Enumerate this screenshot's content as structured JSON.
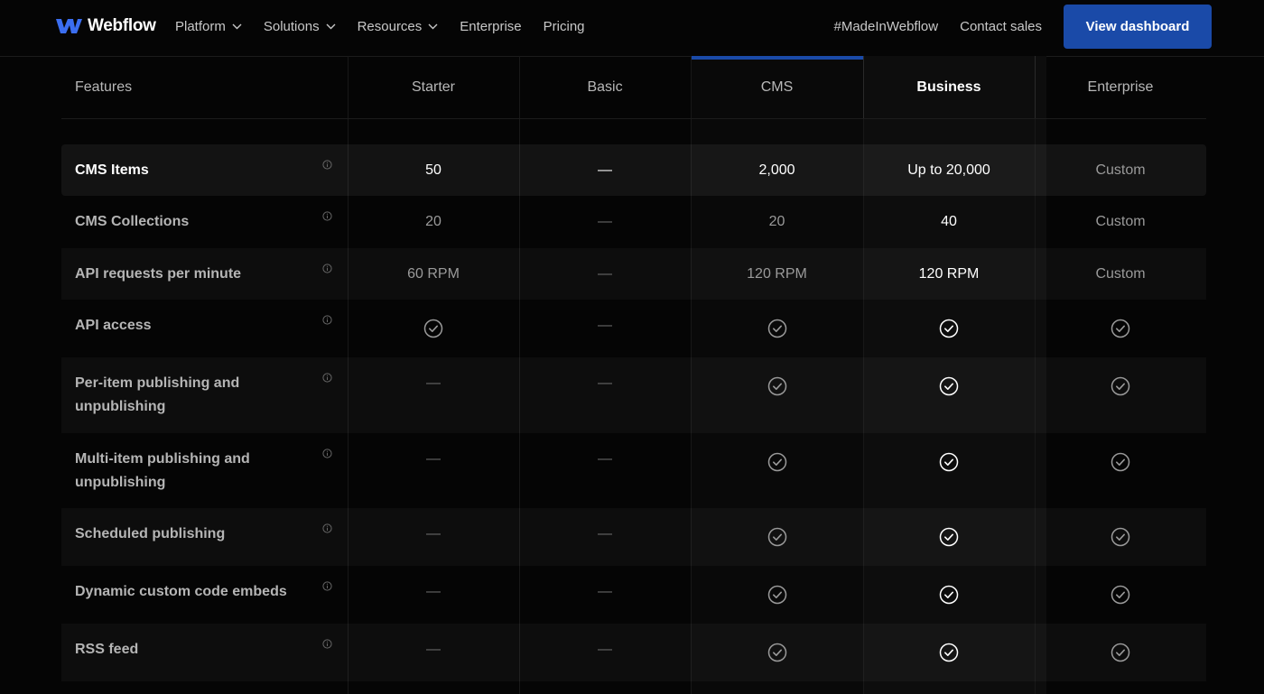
{
  "nav": {
    "logo_text": "Webflow",
    "links": [
      {
        "label": "Platform",
        "dropdown": true
      },
      {
        "label": "Solutions",
        "dropdown": true
      },
      {
        "label": "Resources",
        "dropdown": true
      },
      {
        "label": "Enterprise",
        "dropdown": false
      },
      {
        "label": "Pricing",
        "dropdown": false
      }
    ],
    "made_in": "#MadeInWebflow",
    "contact": "Contact sales",
    "cta": "View dashboard"
  },
  "table": {
    "headers": [
      "Features",
      "Starter",
      "Basic",
      "CMS",
      "Business",
      "Enterprise"
    ],
    "rows": [
      {
        "feature": "CMS Items",
        "values": [
          "50",
          "—",
          "2,000",
          "Up to 20,000",
          "Custom"
        ]
      },
      {
        "feature": "CMS Collections",
        "values": [
          "20",
          "—",
          "20",
          "40",
          "Custom"
        ]
      },
      {
        "feature": "API requests per minute",
        "values": [
          "60 RPM",
          "—",
          "120 RPM",
          "120 RPM",
          "Custom"
        ]
      },
      {
        "feature": "API access",
        "values": [
          "check",
          "—",
          "check",
          "check",
          "check"
        ]
      },
      {
        "feature": "Per-item publishing and unpublishing",
        "values": [
          "—",
          "—",
          "check",
          "check",
          "check"
        ]
      },
      {
        "feature": "Multi-item publishing and unpublishing",
        "values": [
          "—",
          "—",
          "check",
          "check",
          "check"
        ]
      },
      {
        "feature": "Scheduled publishing",
        "values": [
          "—",
          "—",
          "check",
          "check",
          "check"
        ]
      },
      {
        "feature": "Dynamic custom code embeds",
        "values": [
          "—",
          "—",
          "check",
          "check",
          "check"
        ]
      },
      {
        "feature": "RSS feed",
        "values": [
          "—",
          "—",
          "check",
          "check",
          "check"
        ]
      }
    ]
  },
  "colors": {
    "accent": "#1a4aa8",
    "background": "#050505"
  }
}
